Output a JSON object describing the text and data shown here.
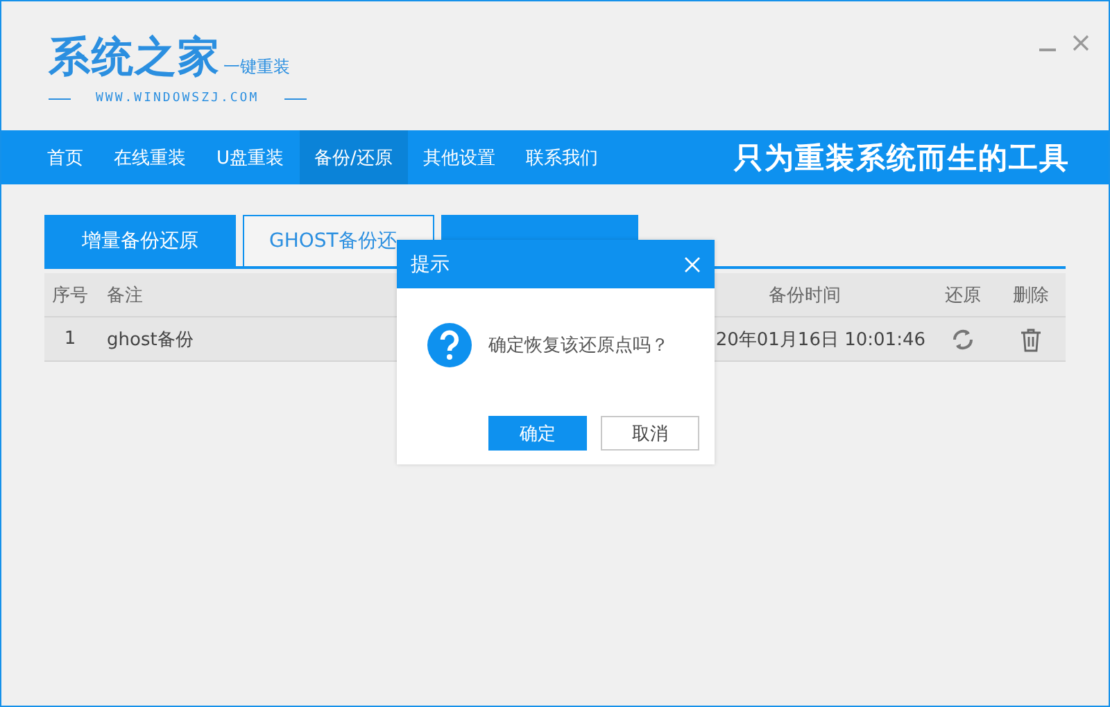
{
  "logo": {
    "title": "系统之家",
    "subtitle": "一键重装",
    "url": "WWW.WINDOWSZJ.COM"
  },
  "nav": {
    "items": [
      {
        "label": "首页",
        "selected": false
      },
      {
        "label": "在线重装",
        "selected": false
      },
      {
        "label": "U盘重装",
        "selected": false
      },
      {
        "label": "备份/还原",
        "selected": true
      },
      {
        "label": "其他设置",
        "selected": false
      },
      {
        "label": "联系我们",
        "selected": false
      }
    ],
    "slogan": "只为重装系统而生的工具"
  },
  "tabs": [
    {
      "label": "增量备份还原",
      "selected": false
    },
    {
      "label": "GHOST备份还",
      "selected": true
    },
    {
      "selected": false
    }
  ],
  "table": {
    "columns": [
      "序号",
      "备注",
      "备份时间",
      "还原",
      "删除"
    ],
    "rows": [
      {
        "index": "1",
        "note": "ghost备份",
        "time": "20年01月16日 10:01:46"
      }
    ]
  },
  "dialog": {
    "title": "提示",
    "message": "确定恢复该还原点吗？",
    "buttons": [
      {
        "label": "确定",
        "kind": "primary"
      },
      {
        "label": "取消",
        "kind": "secondary"
      }
    ]
  }
}
